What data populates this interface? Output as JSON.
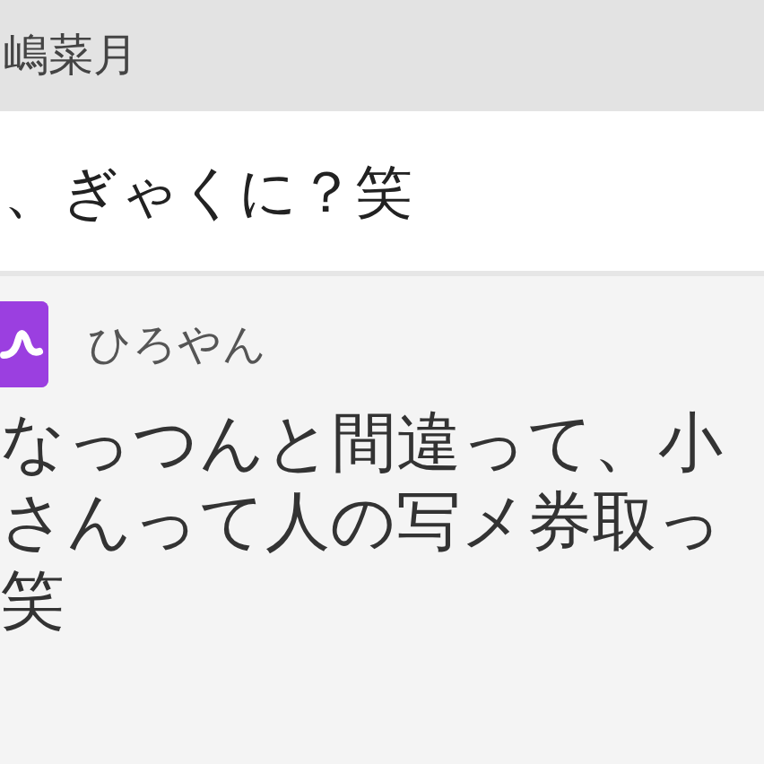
{
  "previous_message": {
    "sender": "嶋菜月",
    "text": "、ぎゃくに？笑"
  },
  "message": {
    "sender": "ひろやん",
    "lines": [
      "なっつんと間違って、小",
      "さんって人の写メ券取っ",
      "笑"
    ]
  }
}
